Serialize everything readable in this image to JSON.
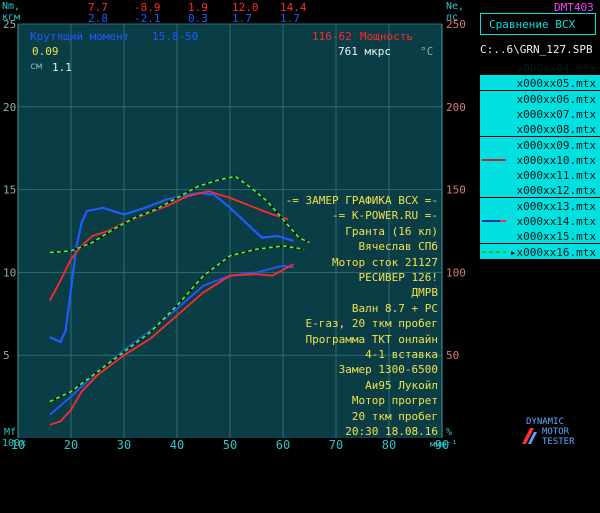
{
  "header": {
    "left_axis_title": [
      "Nm,",
      "кгм"
    ],
    "row1": [
      "7.7",
      "-8.9",
      "1.9",
      "12.0",
      "14.4"
    ],
    "row2": [
      "2.8",
      "-2.1",
      "0.3",
      "1.7",
      "1.7"
    ],
    "right_axis_title": [
      "Ne,",
      "лс"
    ],
    "brand_code": "DMT403"
  },
  "overlay": {
    "torque_label": "Крутящий момент",
    "torque_range": "15.8-50",
    "power_range": "116-62",
    "power_label": "Мощность",
    "value1": "0.09",
    "value_mks": "761 мкрс",
    "unit_c": "°C",
    "cm_label": "см",
    "cm_value": "1.1",
    "mf_label": "Mf",
    "x_prefix": "100x",
    "x_unit": "мин⁻¹",
    "pct": "%"
  },
  "annotations": [
    "-= ЗАМЕР ГРАФИКА ВСХ =-",
    "-= K-POWER.RU =-",
    "Гранта (16 кл)",
    "Вячеслав СПб",
    "Мотор сток 21127",
    "РЕСИВЕР 126!",
    "ДМРВ",
    "Валн 8.7 + РС",
    "Е-газ, 20 ткм пробег",
    "Программа ТКТ онлайн",
    "4-1 вставка",
    "Замер 1300-6500",
    "Аи95 Лукойл",
    "Мотор прогрет",
    "20 ткм пробег",
    "20:30 18.08.16"
  ],
  "sidebar": {
    "compare_button": "Сравнение ВСХ",
    "path": "C:..6\\GRN_127.SPB",
    "files": [
      {
        "label": "x000xx04.mtx",
        "selected": false,
        "legend": ""
      },
      {
        "label": "x000xx05.mtx",
        "selected": true,
        "legend": ""
      },
      {
        "label": "x000xx06.mtx",
        "selected": true,
        "legend": ""
      },
      {
        "label": "x000xx07.mtx",
        "selected": true,
        "legend": ""
      },
      {
        "label": "x000xx08.mtx",
        "selected": true,
        "legend": ""
      },
      {
        "label": "x000xx09.mtx",
        "selected": true,
        "legend": ""
      },
      {
        "label": "x000xx10.mtx",
        "selected": true,
        "legend": "red"
      },
      {
        "label": "x000xx11.mtx",
        "selected": true,
        "legend": ""
      },
      {
        "label": "x000xx12.mtx",
        "selected": true,
        "legend": ""
      },
      {
        "label": "x000xx13.mtx",
        "selected": true,
        "legend": ""
      },
      {
        "label": "x000xx14.mtx",
        "selected": true,
        "legend": "blue"
      },
      {
        "label": "x000xx15.mtx",
        "selected": true,
        "legend": ""
      },
      {
        "label": "▸x000xx16.mtx",
        "selected": true,
        "legend": "green"
      }
    ]
  },
  "logo": [
    "DYNAMIC",
    "MOTOR",
    "TESTER"
  ],
  "colors": {
    "background": "#000000",
    "plot_area": "#0a3d45",
    "grid": "#2c6e73",
    "blue": "#1f5bff",
    "red": "#ff2a2a",
    "green_dash": "#3dff3d",
    "yellow": "#f2e24a",
    "axis_text": "#d87a7a",
    "sidebar": "#00e0e0"
  },
  "chart_data": {
    "type": "line",
    "x_ticks": [
      "10",
      "20",
      "30",
      "40",
      "50",
      "60",
      "70",
      "80",
      "90"
    ],
    "y_left_ticks": [
      "5",
      "10",
      "15",
      "20",
      "25"
    ],
    "y_right_ticks": [
      "50",
      "100",
      "150",
      "200",
      "250"
    ],
    "xlim": [
      10,
      90
    ],
    "ylim_left": [
      0,
      25
    ],
    "ylim_right": [
      0,
      250
    ],
    "series": [
      {
        "axis": "left",
        "color": "#1f5bff",
        "style": "solid",
        "x": [
          16,
          18,
          19,
          20,
          21,
          22,
          23,
          26,
          30,
          34,
          38,
          41,
          44,
          47,
          50,
          53,
          56,
          59,
          62
        ],
        "y": [
          6.1,
          5.8,
          6.5,
          9.0,
          11.5,
          13.0,
          13.7,
          13.9,
          13.5,
          13.9,
          14.4,
          14.6,
          14.8,
          14.7,
          13.9,
          13.0,
          12.1,
          12.2,
          11.9
        ]
      },
      {
        "axis": "left",
        "color": "#ff2a2a",
        "style": "solid",
        "x": [
          16,
          18,
          20,
          22,
          24,
          27,
          30,
          34,
          38,
          42,
          46,
          50,
          54,
          58,
          61
        ],
        "y": [
          8.3,
          9.5,
          10.8,
          11.6,
          12.2,
          12.5,
          13.0,
          13.5,
          14.0,
          14.6,
          14.9,
          14.5,
          14.0,
          13.5,
          13.2
        ]
      },
      {
        "axis": "left",
        "color": "#3dff3d",
        "style": "dashed",
        "x": [
          16,
          20,
          24,
          28,
          32,
          36,
          40,
          44,
          48,
          51,
          54,
          57,
          60,
          63,
          65
        ],
        "y": [
          11.2,
          11.3,
          11.8,
          12.6,
          13.3,
          13.8,
          14.5,
          15.2,
          15.6,
          15.8,
          15.1,
          14.3,
          13.2,
          12.1,
          11.8
        ]
      },
      {
        "axis": "right",
        "color": "#1f5bff",
        "style": "solid",
        "x": [
          16,
          20,
          25,
          30,
          35,
          40,
          45,
          50,
          55,
          60,
          62
        ],
        "y": [
          14,
          25,
          40,
          53,
          65,
          78,
          92,
          98,
          100,
          104,
          103
        ]
      },
      {
        "axis": "right",
        "color": "#ff2a2a",
        "style": "solid",
        "x": [
          16,
          18,
          20,
          22,
          25,
          30,
          35,
          40,
          45,
          50,
          55,
          58,
          62
        ],
        "y": [
          8,
          10,
          17,
          28,
          38,
          50,
          60,
          74,
          88,
          98,
          99,
          98,
          105
        ]
      },
      {
        "axis": "right",
        "color": "#3dff3d",
        "style": "dashed",
        "x": [
          16,
          20,
          25,
          30,
          35,
          40,
          45,
          50,
          55,
          60,
          64
        ],
        "y": [
          22,
          28,
          40,
          52,
          64,
          80,
          98,
          110,
          114,
          116,
          114
        ]
      }
    ]
  }
}
